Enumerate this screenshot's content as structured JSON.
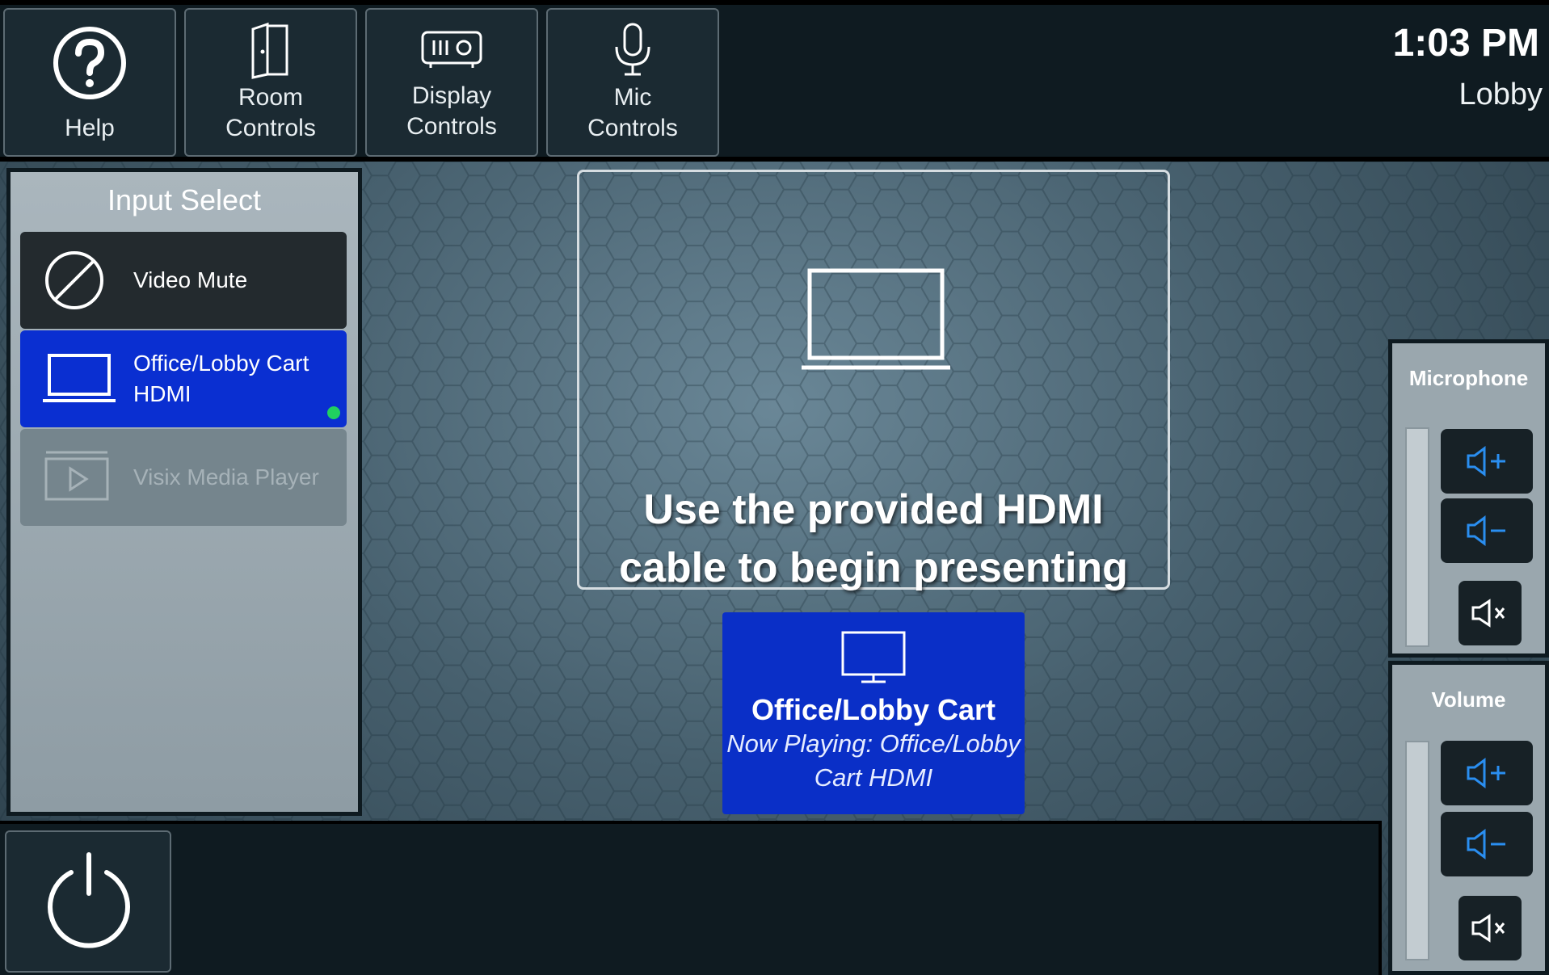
{
  "header": {
    "nav": [
      {
        "id": "help",
        "label_lines": [
          "Help"
        ]
      },
      {
        "id": "room-controls",
        "label_lines": [
          "Room",
          "Controls"
        ]
      },
      {
        "id": "display-controls",
        "label_lines": [
          "Display",
          "Controls"
        ]
      },
      {
        "id": "mic-controls",
        "label_lines": [
          "Mic",
          "Controls"
        ]
      }
    ],
    "time": "1:03 PM",
    "room": "Lobby"
  },
  "input_select": {
    "title": "Input Select",
    "sources": [
      {
        "label_lines": [
          "Video Mute"
        ],
        "state": "normal",
        "icon": "no-video-icon"
      },
      {
        "label_lines": [
          "Office/Lobby Cart",
          "HDMI"
        ],
        "state": "selected",
        "icon": "laptop-icon"
      },
      {
        "label_lines": [
          "Visix Media Player"
        ],
        "state": "disabled",
        "icon": "media-player-icon"
      }
    ]
  },
  "message": {
    "lines": [
      "Use the provided HDMI",
      "cable to begin presenting"
    ]
  },
  "now_playing": {
    "title": "Office/Lobby Cart",
    "subtitle_lines": [
      "Now Playing: Office/Lobby",
      "Cart HDMI"
    ]
  },
  "microphone": {
    "title": "Microphone",
    "level": 0.0
  },
  "volume": {
    "title": "Volume",
    "level": 0.0
  },
  "colors": {
    "accent_blue": "#0a2fd1",
    "icon_blue": "#2a8ef0",
    "active_dot": "#20d060"
  }
}
